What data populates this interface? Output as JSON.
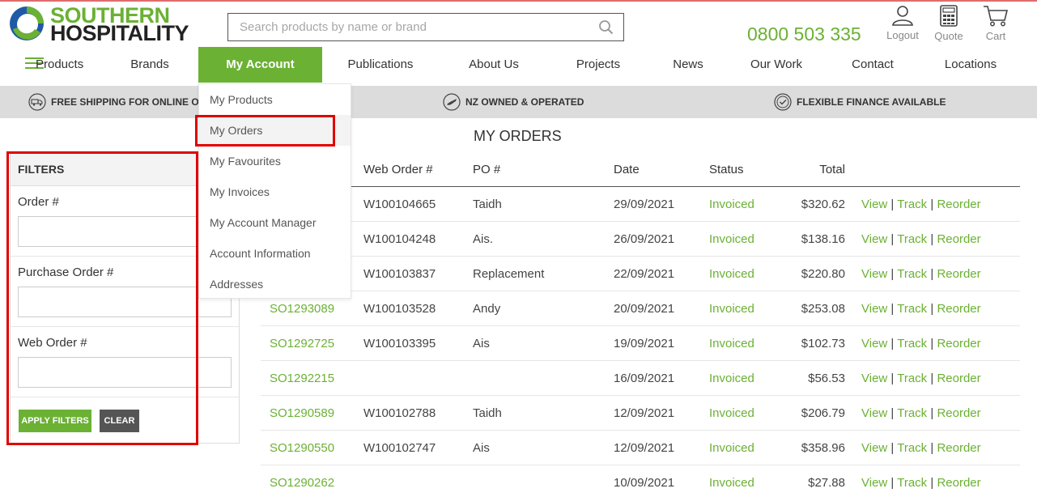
{
  "brand": {
    "line1": "SOUTHERN",
    "line2": "HOSPITALITY",
    "color_green": "#6bb134",
    "color_blue": "#1f5aa6"
  },
  "search": {
    "placeholder": "Search products by name or brand"
  },
  "phone": "0800 503 335",
  "header_icons": [
    {
      "icon": "user-icon",
      "label": "Logout"
    },
    {
      "icon": "calculator-icon",
      "label": "Quote"
    },
    {
      "icon": "cart-icon",
      "label": "Cart"
    }
  ],
  "nav": [
    {
      "label": "Products"
    },
    {
      "label": "Brands"
    },
    {
      "label": "My Account",
      "active": true
    },
    {
      "label": "Publications"
    },
    {
      "label": "About Us"
    },
    {
      "label": "Projects"
    },
    {
      "label": "News"
    },
    {
      "label": "Our Work"
    },
    {
      "label": "Contact"
    },
    {
      "label": "Locations"
    }
  ],
  "infobar": [
    {
      "icon": "truck-icon",
      "text": "FREE SHIPPING FOR ONLINE ORD"
    },
    {
      "icon": "nz-map-icon",
      "text": "NZ OWNED & OPERATED"
    },
    {
      "icon": "check-circle-icon",
      "text": "FLEXIBLE FINANCE AVAILABLE"
    }
  ],
  "account_menu": [
    {
      "label": "My Products"
    },
    {
      "label": "My Orders",
      "hover": true
    },
    {
      "label": "My Favourites"
    },
    {
      "label": "My Invoices"
    },
    {
      "label": "My Account Manager"
    },
    {
      "label": "Account Information"
    },
    {
      "label": "Addresses"
    }
  ],
  "filters": {
    "title": "FILTERS",
    "fields": [
      {
        "label": "Order #",
        "value": ""
      },
      {
        "label": "Purchase Order #",
        "value": ""
      },
      {
        "label": "Web Order #",
        "value": ""
      }
    ],
    "apply_label": "APPLY FILTERS",
    "clear_label": "CLEAR"
  },
  "orders": {
    "title": "MY ORDERS",
    "columns": [
      "Web Order #",
      "PO #",
      "Date",
      "Status",
      "Total"
    ],
    "action_labels": {
      "view": "View",
      "track": "Track",
      "reorder": "Reorder",
      "separator": "|"
    },
    "rows": [
      {
        "order": "",
        "web_order": "W100104665",
        "po": "Taidh",
        "date": "29/09/2021",
        "status": "Invoiced",
        "total": "$320.62"
      },
      {
        "order": "",
        "web_order": "W100104248",
        "po": "Ais.",
        "date": "26/09/2021",
        "status": "Invoiced",
        "total": "$138.16"
      },
      {
        "order": "",
        "web_order": "W100103837",
        "po": "Replacement",
        "date": "22/09/2021",
        "status": "Invoiced",
        "total": "$220.80"
      },
      {
        "order": "SO1293089",
        "web_order": "W100103528",
        "po": "Andy",
        "date": "20/09/2021",
        "status": "Invoiced",
        "total": "$253.08"
      },
      {
        "order": "SO1292725",
        "web_order": "W100103395",
        "po": "Ais",
        "date": "19/09/2021",
        "status": "Invoiced",
        "total": "$102.73"
      },
      {
        "order": "SO1292215",
        "web_order": "",
        "po": "",
        "date": "16/09/2021",
        "status": "Invoiced",
        "total": "$56.53"
      },
      {
        "order": "SO1290589",
        "web_order": "W100102788",
        "po": "Taidh",
        "date": "12/09/2021",
        "status": "Invoiced",
        "total": "$206.79"
      },
      {
        "order": "SO1290550",
        "web_order": "W100102747",
        "po": "Ais",
        "date": "12/09/2021",
        "status": "Invoiced",
        "total": "$358.96"
      },
      {
        "order": "SO1290262",
        "web_order": "",
        "po": "",
        "date": "10/09/2021",
        "status": "Invoiced",
        "total": "$27.88"
      }
    ]
  },
  "annotation_color": "#e00000"
}
